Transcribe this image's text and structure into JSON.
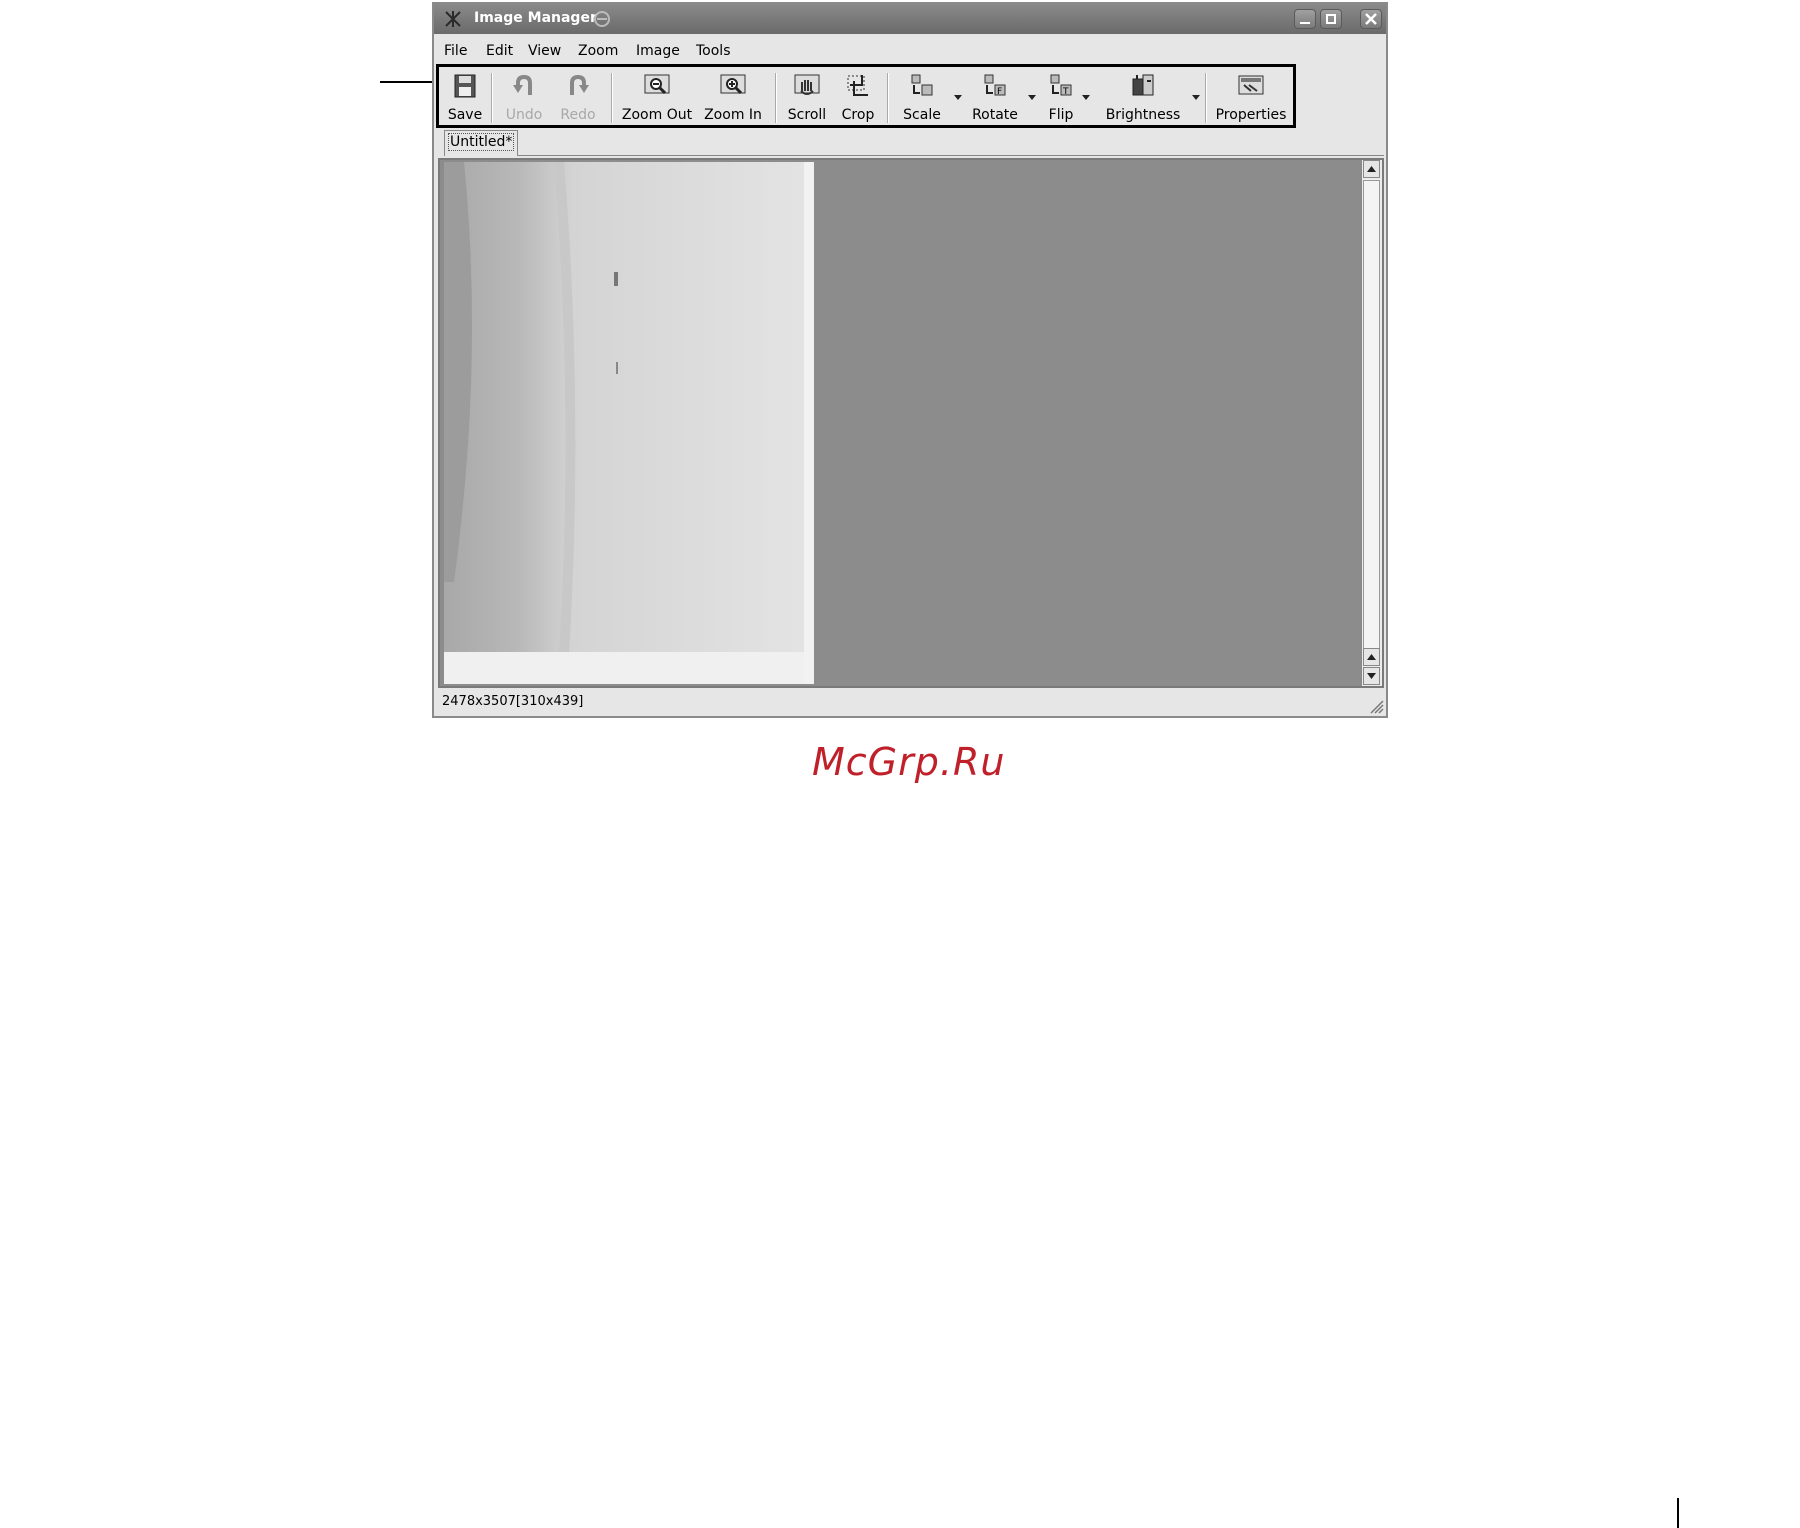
{
  "window": {
    "title": "Image Manager",
    "buttons": [
      "minimize-icon",
      "maximize-icon",
      "close-icon"
    ]
  },
  "menubar": {
    "items": [
      {
        "label": "File"
      },
      {
        "label": "Edit"
      },
      {
        "label": "View"
      },
      {
        "label": "Zoom"
      },
      {
        "label": "Image"
      },
      {
        "label": "Tools"
      }
    ]
  },
  "toolbar": {
    "save": "Save",
    "undo": "Undo",
    "redo": "Redo",
    "zoom_out": "Zoom Out",
    "zoom_in": "Zoom In",
    "scroll": "Scroll",
    "crop": "Crop",
    "scale": "Scale",
    "rotate": "Rotate",
    "flip": "Flip",
    "brightness": "Brightness",
    "properties": "Properties",
    "disabled": [
      "Undo",
      "Redo"
    ]
  },
  "tabs": [
    {
      "label": "Untitled*"
    }
  ],
  "statusbar": {
    "text": "2478x3507[310x439]"
  },
  "watermark": "McGrp.Ru",
  "colors": {
    "watermark": "#c0202a",
    "canvas": "#8c8c8c",
    "window": "#e6e6e6"
  }
}
